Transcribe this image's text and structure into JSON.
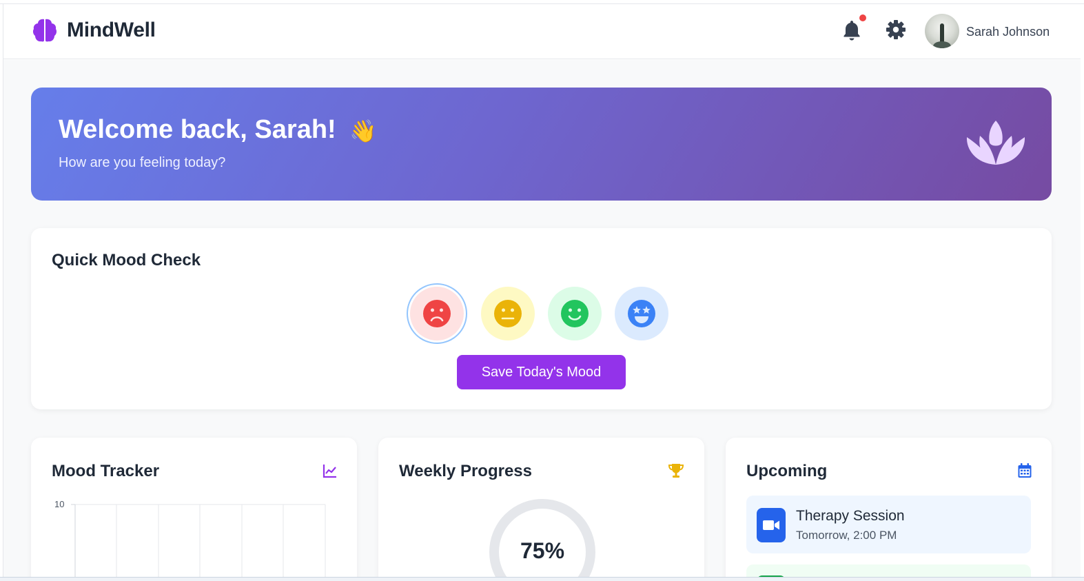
{
  "app": {
    "name": "MindWell"
  },
  "header": {
    "user_name": "Sarah Johnson",
    "notification_icon": "bell-icon",
    "settings_icon": "gear-icon"
  },
  "hero": {
    "title": "Welcome back, Sarah!",
    "wave": "👋",
    "subtitle": "How are you feeling today?",
    "icon": "lotus-icon"
  },
  "mood_check": {
    "title": "Quick Mood Check",
    "moods": [
      {
        "name": "sad",
        "icon": "sad-face-icon",
        "color": "#ef4444",
        "selected": true
      },
      {
        "name": "neutral",
        "icon": "neutral-face-icon",
        "color": "#eab308",
        "selected": false
      },
      {
        "name": "happy",
        "icon": "smile-face-icon",
        "color": "#22c55e",
        "selected": false
      },
      {
        "name": "great",
        "icon": "star-eyes-face-icon",
        "color": "#3b82f6",
        "selected": false
      }
    ],
    "save_label": "Save Today's Mood"
  },
  "mood_tracker": {
    "title": "Mood Tracker",
    "icon": "line-chart-icon"
  },
  "chart_data": {
    "type": "line",
    "y_ticks": [
      "10"
    ],
    "grid": true
  },
  "weekly_progress": {
    "title": "Weekly Progress",
    "icon": "trophy-icon",
    "percent_label": "75%",
    "value": 0.75
  },
  "upcoming": {
    "title": "Upcoming",
    "icon": "calendar-icon",
    "events": [
      {
        "title": "Therapy Session",
        "time": "Tomorrow, 2:00 PM",
        "icon": "video-icon"
      }
    ]
  },
  "colors": {
    "brand": "#9333ea",
    "hero_start": "#667eea",
    "hero_end": "#764ba2",
    "notification": "#ef4444"
  }
}
